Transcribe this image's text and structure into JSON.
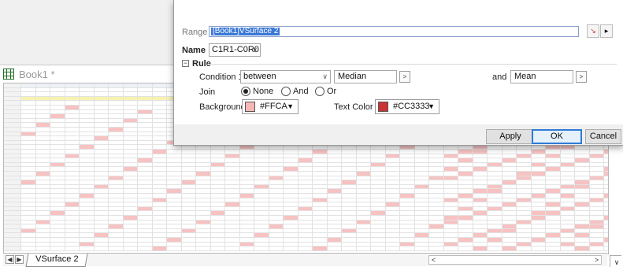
{
  "book": {
    "title": "Book1 *",
    "sheet_tab": "VSurface 2"
  },
  "dialog": {
    "range_label": "Range",
    "range_value": "[Book1]VSurface 2",
    "name_label": "Name",
    "name_value": "C1R1-C0R0",
    "rule_label": "Rule",
    "condition_label": "Condition 1",
    "condition_value": "between",
    "value1": "Median",
    "and_label": "and",
    "value2": "Mean",
    "join_label": "Join",
    "join_options": [
      "None",
      "And",
      "Or"
    ],
    "join_selected": "None",
    "background_label": "Background",
    "background_value": "#FFCA",
    "background_color": "#f7b7b7",
    "text_color_label": "Text Color",
    "text_color_value": "#CC3333",
    "text_color": "#cc3333",
    "apply_label": "Apply",
    "ok_label": "OK",
    "cancel_label": "Cancel",
    "more_button": ">",
    "range_arrow": "▸"
  },
  "icons": {
    "dropdown": "∨",
    "collapse": "−",
    "nav_left": "◀",
    "nav_right": "▶",
    "scroll_left": "<",
    "scroll_right": ">",
    "scroll_down": "∨",
    "color_arrow": "▼"
  },
  "colors": {
    "highlight_bg": "#f7c2c2",
    "header_bg": "#f7f2b0",
    "accent": "#2e7bd6"
  }
}
